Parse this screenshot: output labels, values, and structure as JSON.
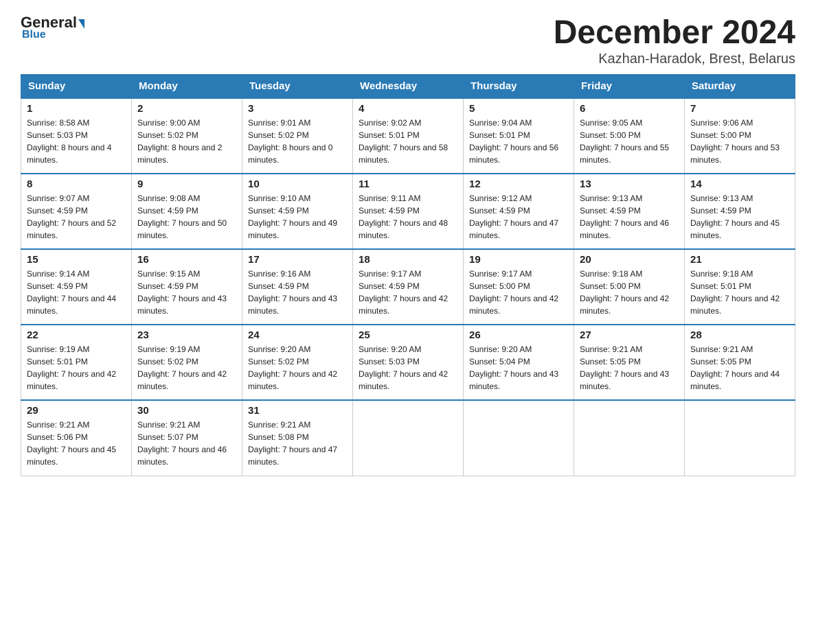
{
  "header": {
    "logo_general": "General",
    "logo_blue": "Blue",
    "month_title": "December 2024",
    "location": "Kazhan-Haradok, Brest, Belarus"
  },
  "columns": [
    "Sunday",
    "Monday",
    "Tuesday",
    "Wednesday",
    "Thursday",
    "Friday",
    "Saturday"
  ],
  "weeks": [
    [
      {
        "day": "1",
        "sunrise": "8:58 AM",
        "sunset": "5:03 PM",
        "daylight": "8 hours and 4 minutes."
      },
      {
        "day": "2",
        "sunrise": "9:00 AM",
        "sunset": "5:02 PM",
        "daylight": "8 hours and 2 minutes."
      },
      {
        "day": "3",
        "sunrise": "9:01 AM",
        "sunset": "5:02 PM",
        "daylight": "8 hours and 0 minutes."
      },
      {
        "day": "4",
        "sunrise": "9:02 AM",
        "sunset": "5:01 PM",
        "daylight": "7 hours and 58 minutes."
      },
      {
        "day": "5",
        "sunrise": "9:04 AM",
        "sunset": "5:01 PM",
        "daylight": "7 hours and 56 minutes."
      },
      {
        "day": "6",
        "sunrise": "9:05 AM",
        "sunset": "5:00 PM",
        "daylight": "7 hours and 55 minutes."
      },
      {
        "day": "7",
        "sunrise": "9:06 AM",
        "sunset": "5:00 PM",
        "daylight": "7 hours and 53 minutes."
      }
    ],
    [
      {
        "day": "8",
        "sunrise": "9:07 AM",
        "sunset": "4:59 PM",
        "daylight": "7 hours and 52 minutes."
      },
      {
        "day": "9",
        "sunrise": "9:08 AM",
        "sunset": "4:59 PM",
        "daylight": "7 hours and 50 minutes."
      },
      {
        "day": "10",
        "sunrise": "9:10 AM",
        "sunset": "4:59 PM",
        "daylight": "7 hours and 49 minutes."
      },
      {
        "day": "11",
        "sunrise": "9:11 AM",
        "sunset": "4:59 PM",
        "daylight": "7 hours and 48 minutes."
      },
      {
        "day": "12",
        "sunrise": "9:12 AM",
        "sunset": "4:59 PM",
        "daylight": "7 hours and 47 minutes."
      },
      {
        "day": "13",
        "sunrise": "9:13 AM",
        "sunset": "4:59 PM",
        "daylight": "7 hours and 46 minutes."
      },
      {
        "day": "14",
        "sunrise": "9:13 AM",
        "sunset": "4:59 PM",
        "daylight": "7 hours and 45 minutes."
      }
    ],
    [
      {
        "day": "15",
        "sunrise": "9:14 AM",
        "sunset": "4:59 PM",
        "daylight": "7 hours and 44 minutes."
      },
      {
        "day": "16",
        "sunrise": "9:15 AM",
        "sunset": "4:59 PM",
        "daylight": "7 hours and 43 minutes."
      },
      {
        "day": "17",
        "sunrise": "9:16 AM",
        "sunset": "4:59 PM",
        "daylight": "7 hours and 43 minutes."
      },
      {
        "day": "18",
        "sunrise": "9:17 AM",
        "sunset": "4:59 PM",
        "daylight": "7 hours and 42 minutes."
      },
      {
        "day": "19",
        "sunrise": "9:17 AM",
        "sunset": "5:00 PM",
        "daylight": "7 hours and 42 minutes."
      },
      {
        "day": "20",
        "sunrise": "9:18 AM",
        "sunset": "5:00 PM",
        "daylight": "7 hours and 42 minutes."
      },
      {
        "day": "21",
        "sunrise": "9:18 AM",
        "sunset": "5:01 PM",
        "daylight": "7 hours and 42 minutes."
      }
    ],
    [
      {
        "day": "22",
        "sunrise": "9:19 AM",
        "sunset": "5:01 PM",
        "daylight": "7 hours and 42 minutes."
      },
      {
        "day": "23",
        "sunrise": "9:19 AM",
        "sunset": "5:02 PM",
        "daylight": "7 hours and 42 minutes."
      },
      {
        "day": "24",
        "sunrise": "9:20 AM",
        "sunset": "5:02 PM",
        "daylight": "7 hours and 42 minutes."
      },
      {
        "day": "25",
        "sunrise": "9:20 AM",
        "sunset": "5:03 PM",
        "daylight": "7 hours and 42 minutes."
      },
      {
        "day": "26",
        "sunrise": "9:20 AM",
        "sunset": "5:04 PM",
        "daylight": "7 hours and 43 minutes."
      },
      {
        "day": "27",
        "sunrise": "9:21 AM",
        "sunset": "5:05 PM",
        "daylight": "7 hours and 43 minutes."
      },
      {
        "day": "28",
        "sunrise": "9:21 AM",
        "sunset": "5:05 PM",
        "daylight": "7 hours and 44 minutes."
      }
    ],
    [
      {
        "day": "29",
        "sunrise": "9:21 AM",
        "sunset": "5:06 PM",
        "daylight": "7 hours and 45 minutes."
      },
      {
        "day": "30",
        "sunrise": "9:21 AM",
        "sunset": "5:07 PM",
        "daylight": "7 hours and 46 minutes."
      },
      {
        "day": "31",
        "sunrise": "9:21 AM",
        "sunset": "5:08 PM",
        "daylight": "7 hours and 47 minutes."
      },
      null,
      null,
      null,
      null
    ]
  ]
}
